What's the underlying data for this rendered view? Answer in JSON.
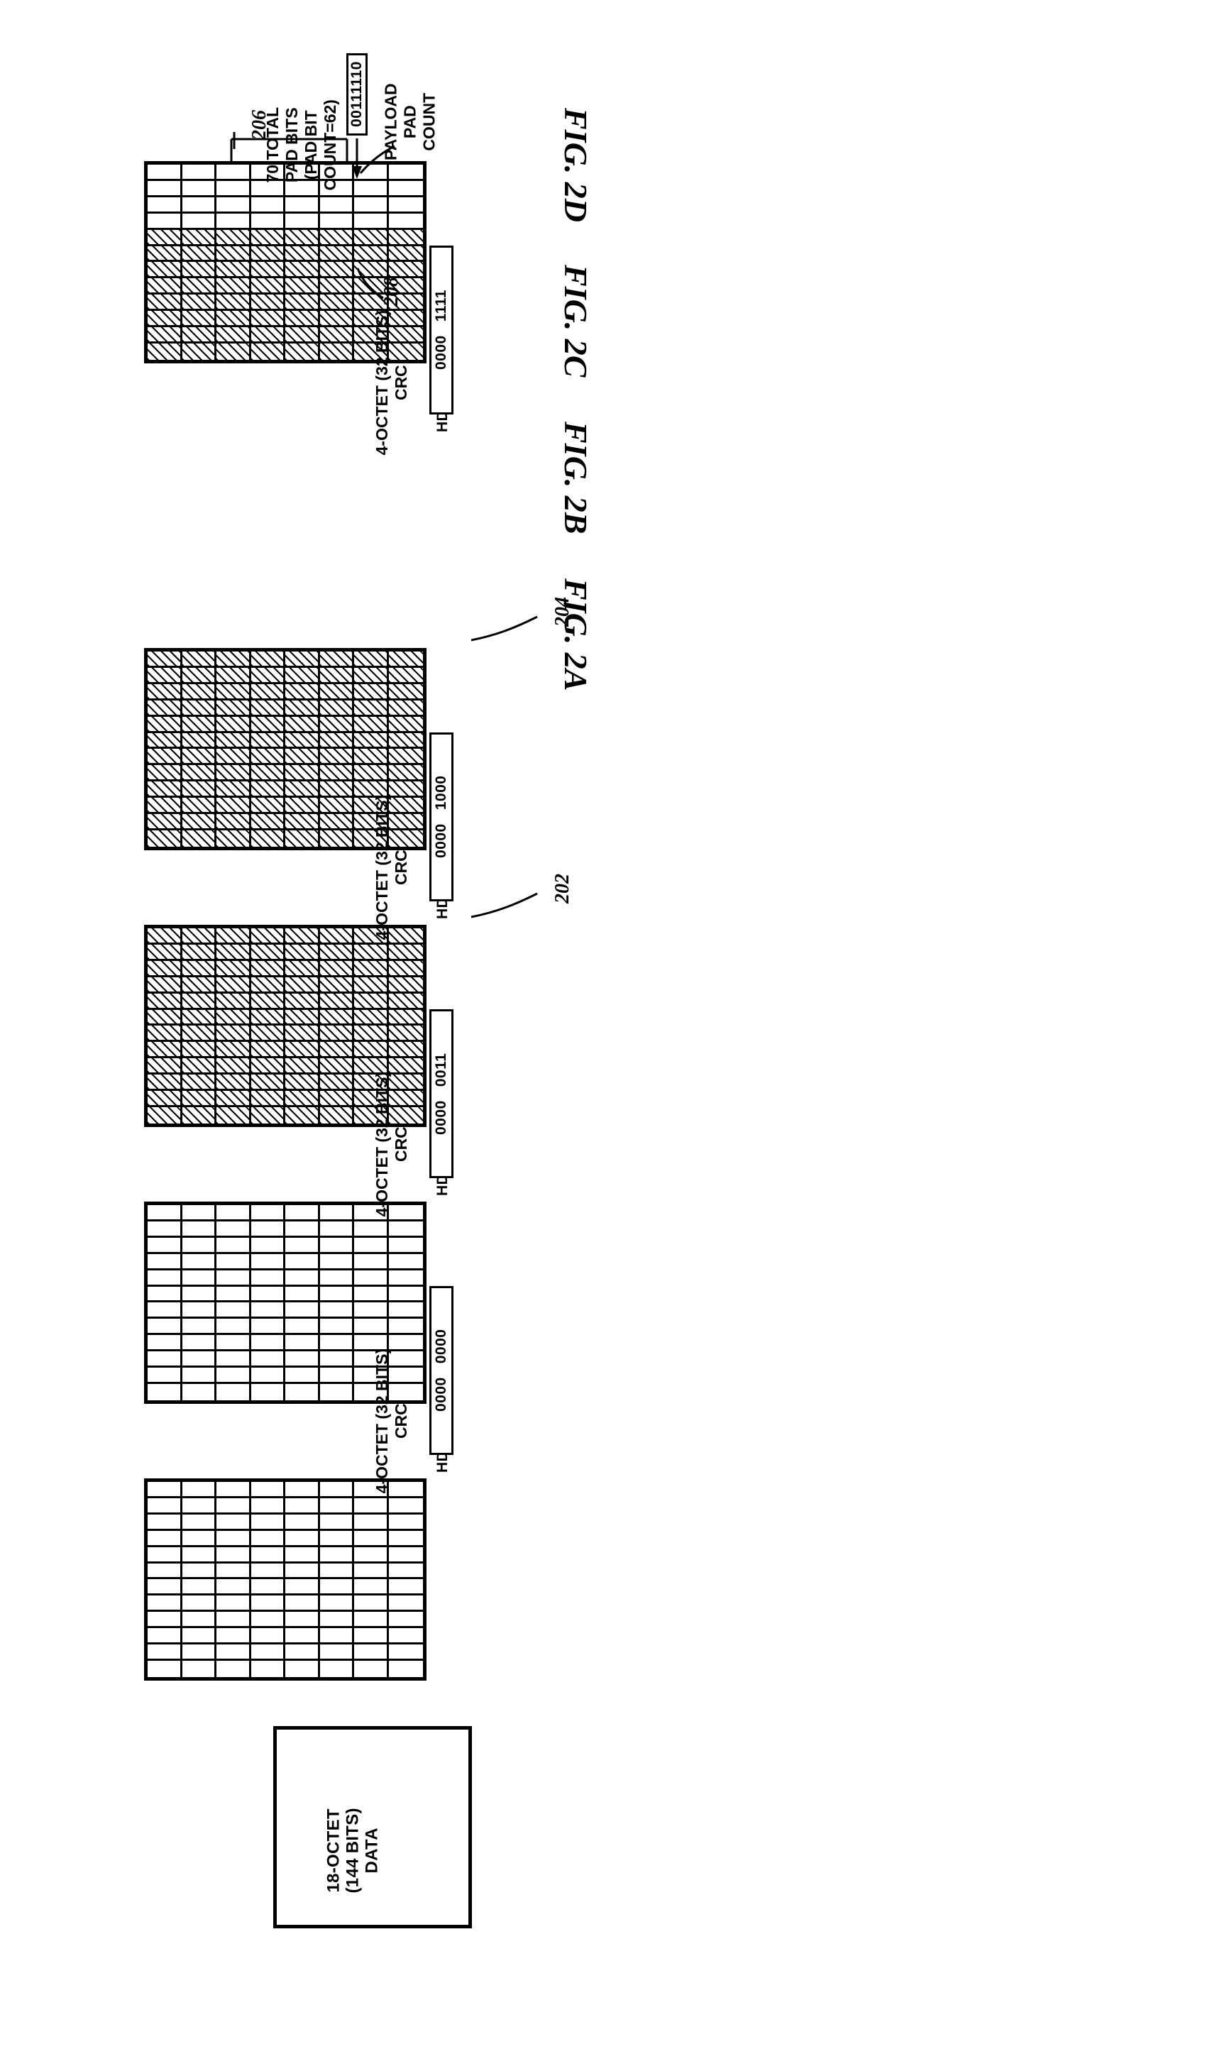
{
  "figure": {
    "titles": [
      {
        "id": "fig2a",
        "label": "FIG. 2A"
      },
      {
        "id": "fig2b",
        "label": "FIG. 2B"
      },
      {
        "id": "fig2c",
        "label": "FIG. 2C"
      },
      {
        "id": "fig2d",
        "label": "FIG. 2D"
      }
    ]
  },
  "data_block": {
    "label": "18-OCTET\n(144 BITS)\nDATA"
  },
  "panels": [
    {
      "id": "panel-grid-plain",
      "grid": {
        "cols": 12,
        "rows": 8,
        "hatched_from_col": null
      },
      "crc_label": null,
      "hdr": null
    },
    {
      "id": "panel-2a",
      "grid": {
        "cols": 12,
        "rows": 8,
        "hatched_from_col": null
      },
      "crc_label": "4-OCTET (32\nBITS) CRC",
      "hdr": {
        "prefix": "HDR:",
        "value": "0000   0000"
      }
    },
    {
      "id": "panel-2b",
      "grid": {
        "cols": 12,
        "rows": 8,
        "hatched_from_col": 11
      },
      "crc_label": "4-OCTET (32\nBITS) CRC",
      "hdr": {
        "prefix": "HDR:",
        "value": "0000   0011"
      },
      "ref": "202"
    },
    {
      "id": "panel-2c",
      "grid": {
        "cols": 12,
        "rows": 8,
        "hatched_from_col": 11
      },
      "crc_label": "4-OCTET (32\nBITS) CRC",
      "hdr": {
        "prefix": "HDR:",
        "value": "0000   1000"
      },
      "ref": "204"
    },
    {
      "id": "panel-2d",
      "grid": {
        "cols": 12,
        "rows": 8,
        "hatched_from_col": 4
      },
      "crc_label": "4-OCTET (32\nBITS) CRC",
      "hdr": {
        "prefix": "HDR:",
        "value": "0000   1111"
      },
      "ref_pad": "206",
      "ref_crc": "208"
    }
  ],
  "annotations": {
    "total_pad_bits": "70 TOTAL\nPAD BITS\n(PAD BIT\nCOUNT=62)",
    "pad_value": "00111110",
    "payload_pad_count": "PAYLOAD\nPAD\nCOUNT"
  },
  "refs": {
    "r202": "202",
    "r204": "204",
    "r206": "206",
    "r208": "208"
  }
}
